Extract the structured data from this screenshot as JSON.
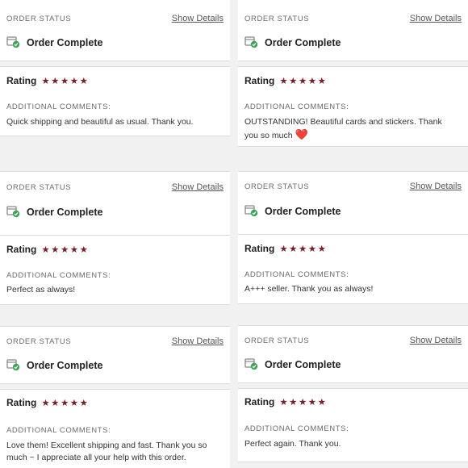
{
  "labels": {
    "order_status": "ORDER STATUS",
    "show_details": "Show Details",
    "additional_comments": "ADDITIONAL COMMENTS:",
    "rating": "Rating",
    "stars": "★★★★★"
  },
  "reviews": [
    {
      "status": "Order Complete",
      "rating": 5,
      "comment": "Quick shipping and beautiful as usual. Thank you."
    },
    {
      "status": "Order Complete",
      "rating": 5,
      "comment": "OUTSTANDING! Beautiful cards and stickers. Thank you so much",
      "emoji": "❤️"
    },
    {
      "status": "Order Complete",
      "rating": 5,
      "comment": "Perfect as always!"
    },
    {
      "status": "Order Complete",
      "rating": 5,
      "comment": "A+++ seller. Thank you as always!"
    },
    {
      "status": "Order Complete",
      "rating": 5,
      "comment": "Love them! Excellent shipping and fast. Thank you so much ~ I appreciate all your help with this order."
    },
    {
      "status": "Order Complete",
      "rating": 5,
      "comment": "Perfect again. Thank you."
    }
  ],
  "colors": {
    "star": "#7a1f2b",
    "check": "#3aa655",
    "heart": "#d40f2a"
  }
}
